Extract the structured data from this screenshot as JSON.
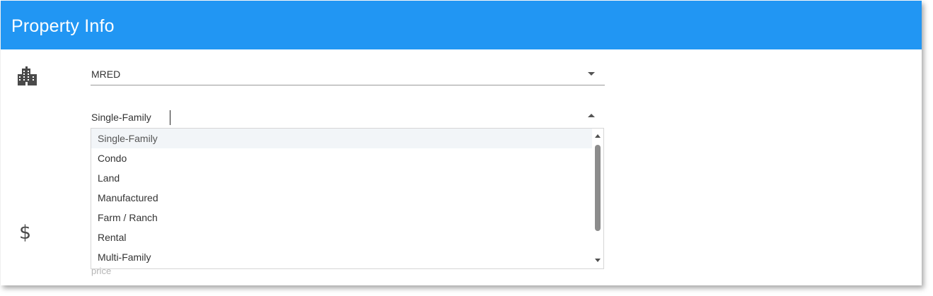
{
  "header": {
    "title": "Property Info",
    "background_color": "#2196f3"
  },
  "icons": {
    "building": "building-icon",
    "dollar": "dollar-sign-icon",
    "dollar_glyph": "$"
  },
  "mls_select": {
    "value": "MRED"
  },
  "property_type_select": {
    "value": "Single-Family",
    "expanded": true
  },
  "property_type_options": [
    {
      "label": "Single-Family",
      "highlighted": true
    },
    {
      "label": "Condo"
    },
    {
      "label": "Land"
    },
    {
      "label": "Manufactured"
    },
    {
      "label": "Farm / Ranch"
    },
    {
      "label": "Rental"
    },
    {
      "label": "Multi-Family"
    }
  ],
  "price_field": {
    "label": "price"
  }
}
